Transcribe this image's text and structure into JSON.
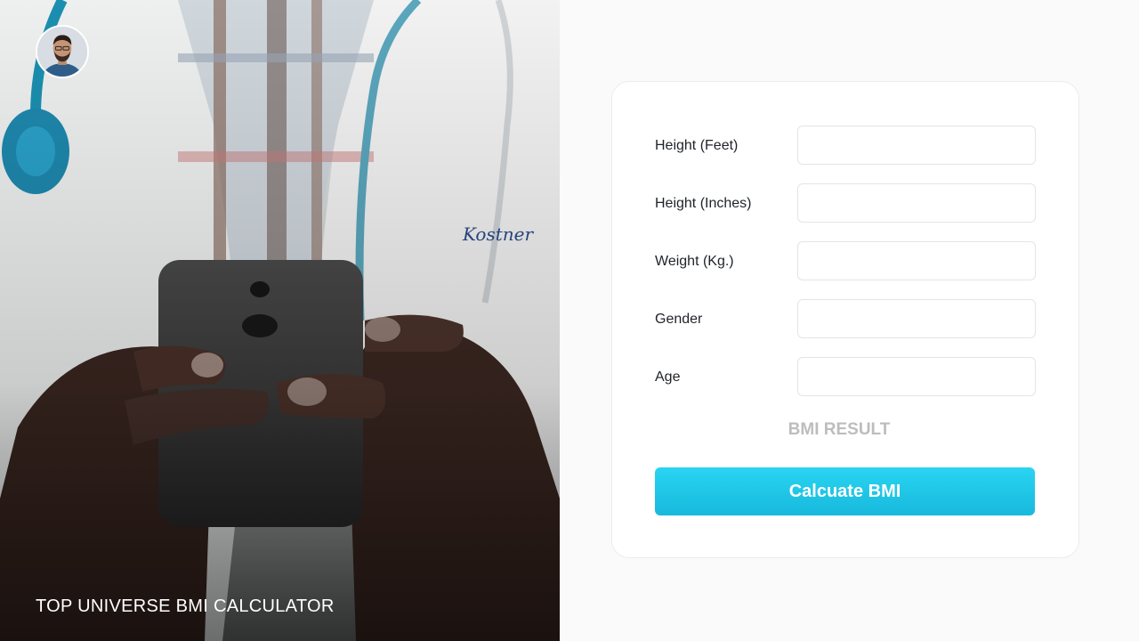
{
  "brand": {
    "title": "TOP UNIVERSE BMI CALCULATOR"
  },
  "avatar": {
    "icon": "user-avatar-icon"
  },
  "form": {
    "fields": [
      {
        "label": "Height (Feet)",
        "value": "",
        "placeholder": ""
      },
      {
        "label": "Height (Inches)",
        "value": "",
        "placeholder": ""
      },
      {
        "label": "Weight (Kg.)",
        "value": "",
        "placeholder": ""
      },
      {
        "label": "Gender",
        "value": "",
        "placeholder": ""
      },
      {
        "label": "Age",
        "value": "",
        "placeholder": ""
      }
    ],
    "result_label": "BMI RESULT",
    "submit_label": "Calcuate BMI"
  },
  "colors": {
    "accent": "#22c6e8",
    "result_text": "#bdbdbd",
    "panel_bg": "#fafafa"
  }
}
